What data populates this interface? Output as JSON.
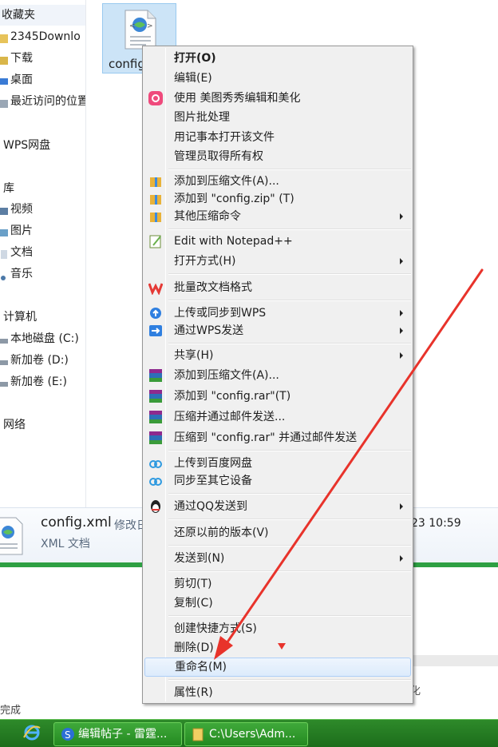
{
  "nav": {
    "favorites": "收藏夹",
    "downloads_2345": "2345Downlo",
    "downloads": "下载",
    "desktop": "桌面",
    "recent": "最近访问的位置",
    "wps_cloud": "WPS网盘",
    "libraries": "库",
    "videos": "视频",
    "pictures": "图片",
    "documents": "文档",
    "music": "音乐",
    "computer": "计算机",
    "disk_c": "本地磁盘 (C:)",
    "disk_d": "新加卷 (D:)",
    "disk_e": "新加卷 (E:)",
    "network": "网络"
  },
  "file": {
    "tile_name": "config",
    "name": "config.xml",
    "modified_label": "修改日",
    "type": "XML 文档",
    "time_fragment": "23 10:59"
  },
  "lower": {
    "status_fragment": "完成",
    "right_fragment": "化"
  },
  "menu": {
    "open": "打开(O)",
    "edit": "编辑(E)",
    "meitu": "使用 美图秀秀编辑和美化",
    "batch_image": "图片批处理",
    "notepad_open": "用记事本打开该文件",
    "admin_owner": "管理员取得所有权",
    "add_archive": "添加到压缩文件(A)...",
    "add_zip": "添加到 \"config.zip\" (T)",
    "other_compress": "其他压缩命令",
    "notepadpp": "Edit with Notepad++",
    "open_with": "打开方式(H)",
    "wps_batch": "批量改文档格式",
    "wps_upload": "上传或同步到WPS",
    "wps_send": "通过WPS发送",
    "share": "共享(H)",
    "rar_add_archive": "添加到压缩文件(A)...",
    "rar_add": "添加到 \"config.rar\"(T)",
    "rar_email": "压缩并通过邮件发送...",
    "rar_email_named": "压缩到 \"config.rar\" 并通过邮件发送",
    "baidu_upload": "上传到百度网盘",
    "sync_devices": "同步至其它设备",
    "qq_send": "通过QQ发送到",
    "restore": "还原以前的版本(V)",
    "send_to": "发送到(N)",
    "cut": "剪切(T)",
    "copy": "复制(C)",
    "shortcut": "创建快捷方式(S)",
    "delete": "删除(D)",
    "rename": "重命名(M)",
    "properties": "属性(R)"
  },
  "taskbar": {
    "sogou_window": "编辑帖子 - 雷霆...",
    "explorer_window": "C:\\Users\\Adm..."
  },
  "colors": {
    "annotation_arrow": "#e8332b",
    "taskbar": "#2a8a25",
    "selection": "#cce4f7"
  }
}
